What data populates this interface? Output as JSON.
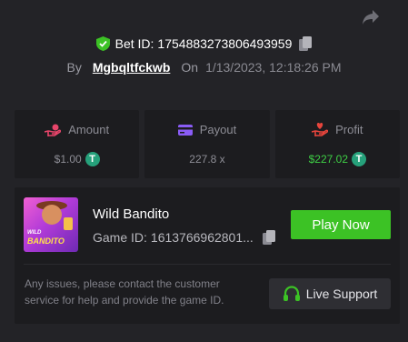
{
  "header": {
    "bet_id_label": "Bet ID:",
    "bet_id": "1754883273806493959",
    "by_label": "By",
    "username": "Mgbqltfckwb",
    "on_label": "On",
    "date": "1/13/2023, 12:18:26 PM"
  },
  "stats": {
    "amount": {
      "label": "Amount",
      "value": "$1.00",
      "icon": "hand-coins-icon"
    },
    "payout": {
      "label": "Payout",
      "value": "227.8 x",
      "icon": "card-icon"
    },
    "profit": {
      "label": "Profit",
      "value": "$227.02",
      "icon": "hand-heart-icon"
    }
  },
  "currency_symbol": "T",
  "game": {
    "title": "Wild Bandito",
    "id_label": "Game ID:",
    "id": "1613766962801...",
    "thumb_text_top": "WILD",
    "thumb_text_bottom": "BANDITO",
    "play_label": "Play Now"
  },
  "support": {
    "message": "Any issues, please contact the customer service for help and provide the game ID.",
    "button_label": "Live Support"
  },
  "colors": {
    "accent_green": "#3cc225",
    "profit_green": "#3ecf45",
    "tether": "#26a17b",
    "amount_icon": "#e8456a",
    "payout_icon": "#8a5cf6",
    "profit_icon": "#e8453c"
  }
}
